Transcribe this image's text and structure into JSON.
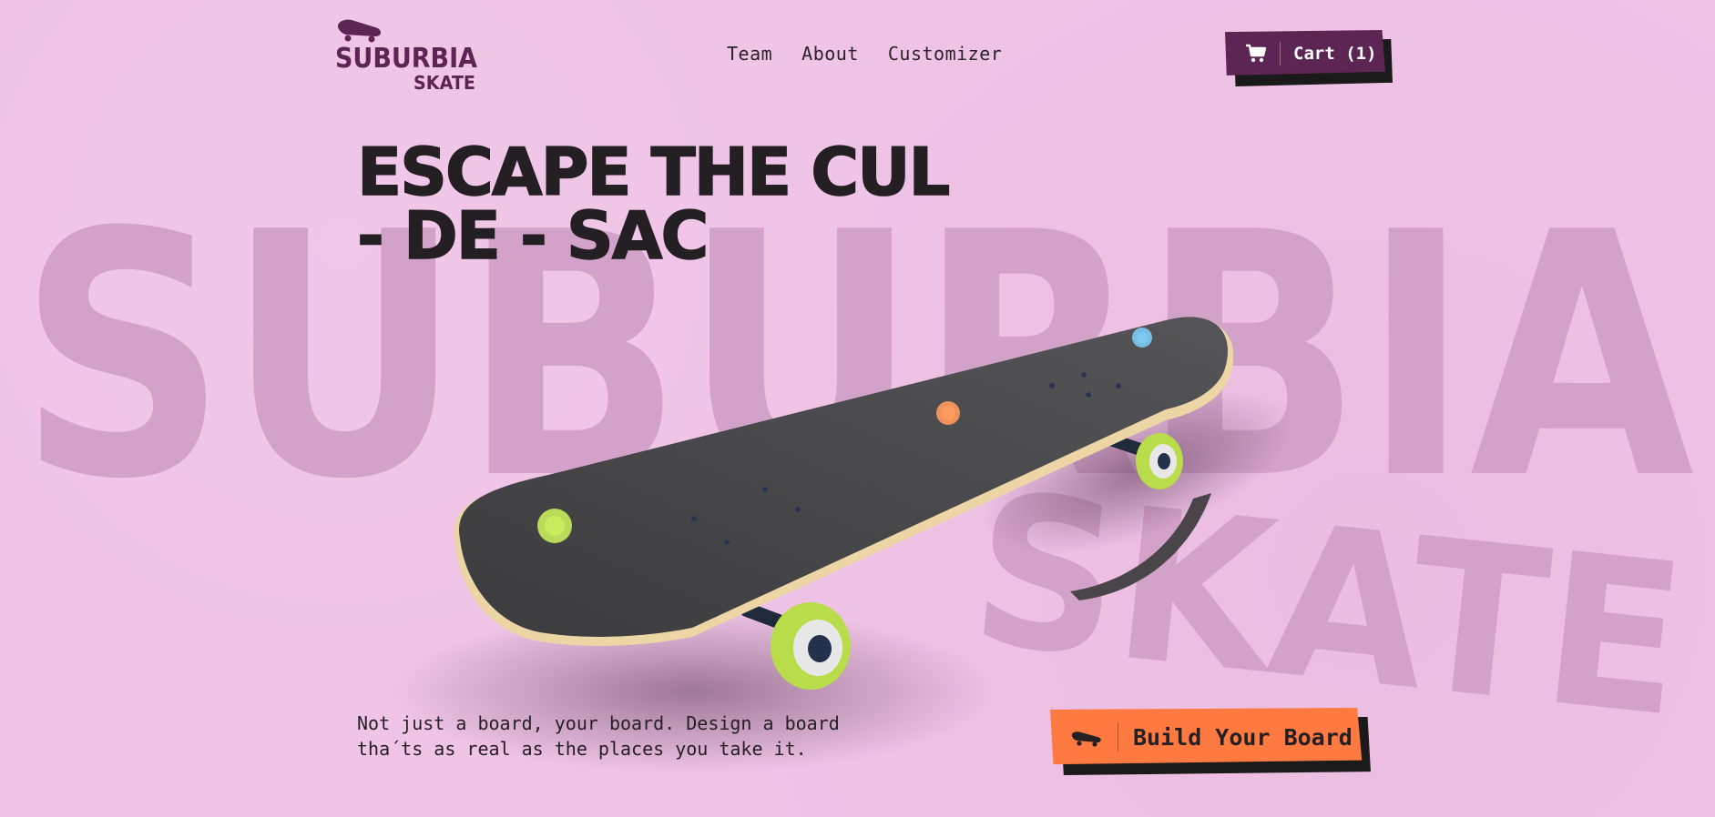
{
  "brand": {
    "logo_line1": "SUBURBIA",
    "logo_line2": "SKATE",
    "background_word1": "SUBURBIA",
    "background_word2": "SKATE"
  },
  "nav": {
    "items": [
      {
        "label": "Team"
      },
      {
        "label": "About"
      },
      {
        "label": "Customizer"
      }
    ]
  },
  "cart": {
    "label": "Cart (1)",
    "icon": "cart-icon"
  },
  "hero": {
    "headline_line1": "ESCAPE THE CUL",
    "headline_line2": "- DE - SAC",
    "tagline_line1": "Not just a board, your board. Design a board",
    "tagline_line2": "tha´ts as real as the places you take it.",
    "cta_label": "Build Your Board",
    "cta_icon": "skateboard-icon"
  },
  "colors": {
    "background": "#efc3e6",
    "background_word": "#d3a2c8",
    "brand_purple": "#5c2553",
    "cta_orange": "#ff7a40",
    "text_dark": "#241f22",
    "hotspot_lime": "#c8ec5c",
    "hotspot_orange": "#ff9a5e",
    "hotspot_blue": "#7ccaf2"
  }
}
